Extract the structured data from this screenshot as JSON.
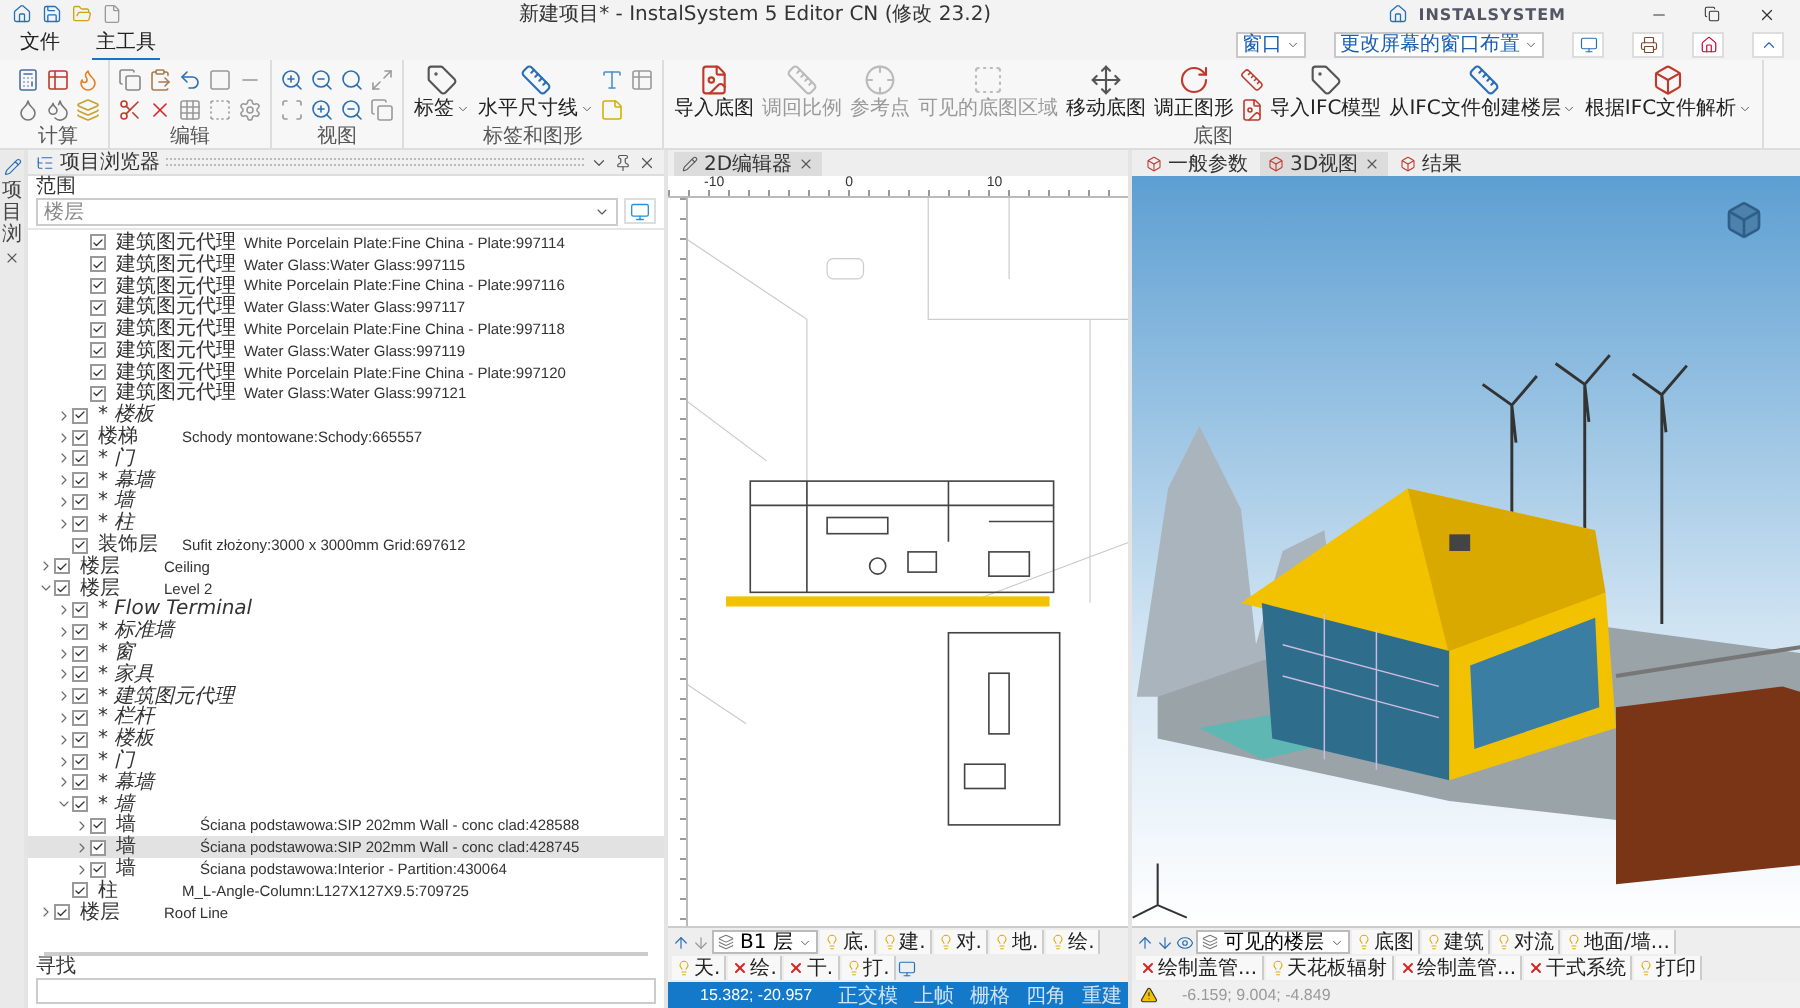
{
  "window": {
    "title": "新建项目* - InstalSystem 5 Editor CN (修改 23.2)",
    "logo": "INSTALSYSTEM"
  },
  "menu": [
    {
      "label": "文件",
      "selected": false
    },
    {
      "label": "主工具",
      "selected": true
    }
  ],
  "layout_controls": {
    "window_menu": "窗口",
    "layout_menu": "更改屏幕的窗口布置"
  },
  "ribbon": [
    {
      "kind": "calc",
      "label": "计算"
    },
    {
      "kind": "edit",
      "label": "编辑"
    },
    {
      "kind": "view",
      "label": "视图"
    },
    {
      "kind": "labels",
      "label": "标签和图形",
      "items": [
        {
          "kind": "large",
          "label": "标签",
          "menu": true,
          "disabled": false
        },
        {
          "kind": "large",
          "label": "水平尺寸线",
          "menu": true,
          "disabled": false
        },
        {
          "kind": "icons"
        }
      ]
    },
    {
      "kind": "underlay",
      "label": "底图",
      "items": [
        {
          "kind": "large",
          "label": "导入底图",
          "menu": false,
          "disabled": false
        },
        {
          "kind": "large",
          "label": "调回比例",
          "menu": false,
          "disabled": true
        },
        {
          "kind": "large",
          "label": "参考点",
          "menu": false,
          "disabled": true
        },
        {
          "kind": "large",
          "label": "可见的底图区域",
          "menu": false,
          "disabled": true
        },
        {
          "kind": "large",
          "label": "移动底图",
          "menu": false,
          "disabled": false
        },
        {
          "kind": "large",
          "label": "调正图形",
          "menu": false,
          "disabled": false
        },
        {
          "kind": "icons"
        },
        {
          "kind": "large",
          "label": "导入IFC模型",
          "menu": false,
          "disabled": false
        },
        {
          "kind": "large",
          "label": "从IFC文件创建楼层",
          "menu": true,
          "disabled": false
        },
        {
          "kind": "large",
          "label": "根据IFC文件解析",
          "menu": true,
          "disabled": false
        }
      ]
    }
  ],
  "side_strip": {
    "label": "项目浏"
  },
  "browser": {
    "title": "项目浏览器",
    "scope_label": "范围",
    "scope_value": "楼层",
    "search_label": "寻找",
    "tree": [
      {
        "kind": "offscreen",
        "children": [
          {
            "kind": "offscreen",
            "children": [
              {
                "kind": "element",
                "type": "建筑图元代理",
                "name": "White Porcelain Plate:Fine China - Plate:997114",
                "checked": true,
                "selected": false
              },
              {
                "kind": "element",
                "type": "建筑图元代理",
                "name": "Water Glass:Water Glass:997115",
                "checked": true,
                "selected": false
              },
              {
                "kind": "element",
                "type": "建筑图元代理",
                "name": "White Porcelain Plate:Fine China - Plate:997116",
                "checked": true,
                "selected": false
              },
              {
                "kind": "element",
                "type": "建筑图元代理",
                "name": "Water Glass:Water Glass:997117",
                "checked": true,
                "selected": false
              },
              {
                "kind": "element",
                "type": "建筑图元代理",
                "name": "White Porcelain Plate:Fine China - Plate:997118",
                "checked": true,
                "selected": false
              },
              {
                "kind": "element",
                "type": "建筑图元代理",
                "name": "Water Glass:Water Glass:997119",
                "checked": true,
                "selected": false
              },
              {
                "kind": "element",
                "type": "建筑图元代理",
                "name": "White Porcelain Plate:Fine China - Plate:997120",
                "checked": true,
                "selected": false
              },
              {
                "kind": "element",
                "type": "建筑图元代理",
                "name": "Water Glass:Water Glass:997121",
                "checked": true,
                "selected": false
              }
            ]
          },
          {
            "kind": "group",
            "label": "* 楼板",
            "checked": true,
            "expanded": false,
            "selected": false
          },
          {
            "kind": "element",
            "type": "楼梯",
            "name": "Schody montowane:Schody:665557",
            "checked": true,
            "expanded": false,
            "selected": false
          },
          {
            "kind": "group",
            "label": "* 门",
            "checked": true,
            "expanded": false,
            "selected": false
          },
          {
            "kind": "group",
            "label": "* 幕墙",
            "checked": true,
            "expanded": false,
            "selected": false
          },
          {
            "kind": "group",
            "label": "* 墙",
            "checked": true,
            "expanded": false,
            "selected": false
          },
          {
            "kind": "group",
            "label": "* 柱",
            "checked": true,
            "expanded": false,
            "selected": false
          },
          {
            "kind": "element",
            "type": "装饰层",
            "name": "Sufit złożony:3000 x 3000mm Grid:697612",
            "checked": true,
            "selected": false
          }
        ]
      },
      {
        "kind": "element",
        "type": "楼层",
        "name": "Ceiling",
        "checked": true,
        "expanded": false,
        "selected": false
      },
      {
        "kind": "element",
        "type": "楼层",
        "name": "Level 2",
        "checked": true,
        "expanded": true,
        "selected": false,
        "children": [
          {
            "kind": "group",
            "label": "* Flow Terminal",
            "checked": true,
            "expanded": false,
            "selected": false
          },
          {
            "kind": "group",
            "label": "* 标准墙",
            "checked": true,
            "expanded": false,
            "selected": false
          },
          {
            "kind": "group",
            "label": "* 窗",
            "checked": true,
            "expanded": false,
            "selected": false
          },
          {
            "kind": "group",
            "label": "* 家具",
            "checked": true,
            "expanded": false,
            "selected": false
          },
          {
            "kind": "group",
            "label": "* 建筑图元代理",
            "checked": true,
            "expanded": false,
            "selected": false
          },
          {
            "kind": "group",
            "label": "* 栏杆",
            "checked": true,
            "expanded": false,
            "selected": false
          },
          {
            "kind": "group",
            "label": "* 楼板",
            "checked": true,
            "expanded": false,
            "selected": false
          },
          {
            "kind": "group",
            "label": "* 门",
            "checked": true,
            "expanded": false,
            "selected": false
          },
          {
            "kind": "group",
            "label": "* 幕墙",
            "checked": true,
            "expanded": false,
            "selected": false
          },
          {
            "kind": "group",
            "label": "* 墙",
            "checked": true,
            "expanded": true,
            "selected": false,
            "children": [
              {
                "kind": "element",
                "type": "墙",
                "name": "Ściana podstawowa:SIP 202mm Wall - conc clad:428588",
                "checked": true,
                "expanded": false,
                "selected": false
              },
              {
                "kind": "element",
                "type": "墙",
                "name": "Ściana podstawowa:SIP 202mm Wall - conc clad:428745",
                "checked": true,
                "expanded": false,
                "selected": true
              },
              {
                "kind": "element",
                "type": "墙",
                "name": "Ściana podstawowa:Interior - Partition:430064",
                "checked": true,
                "expanded": false,
                "selected": false
              }
            ]
          },
          {
            "kind": "element",
            "type": "柱",
            "name": "M_L-Angle-Column:L127X127X9.5:709725",
            "checked": true,
            "selected": false
          }
        ]
      },
      {
        "kind": "element",
        "type": "楼层",
        "name": "Roof Line",
        "checked": true,
        "expanded": false,
        "selected": false
      }
    ]
  },
  "editor2d": {
    "tab": "2D编辑器",
    "ruler": [
      "-10",
      "0",
      "10"
    ],
    "floor": "B1 层",
    "layers": [
      {
        "label": "底.",
        "visible": true
      },
      {
        "label": "建.",
        "visible": true
      },
      {
        "label": "对.",
        "visible": true
      },
      {
        "label": "地.",
        "visible": true
      },
      {
        "label": "绘.",
        "visible": true
      },
      {
        "label": "天.",
        "visible": true
      },
      {
        "label": "绘.",
        "visible": false
      },
      {
        "label": "干.",
        "visible": false
      },
      {
        "label": "打.",
        "visible": true
      }
    ],
    "status": {
      "active": true,
      "coords": "15.382; -20.957",
      "toggles": [
        "正交模",
        "上帧",
        "栅格",
        "四角",
        "重建"
      ]
    }
  },
  "view3d": {
    "tabs": [
      {
        "label": "一般参数",
        "selected": false
      },
      {
        "label": "3D视图",
        "selected": true
      },
      {
        "label": "结果",
        "selected": false
      }
    ],
    "floor": "可见的楼层",
    "layers": [
      {
        "label": "底图",
        "visible": true
      },
      {
        "label": "建筑",
        "visible": true
      },
      {
        "label": "对流",
        "visible": true
      },
      {
        "label": "地面/墙...",
        "visible": true
      },
      {
        "label": "绘制盖管...",
        "visible": false
      },
      {
        "label": "天花板辐射",
        "visible": true
      },
      {
        "label": "绘制盖管...",
        "visible": false
      },
      {
        "label": "干式系统",
        "visible": false
      },
      {
        "label": "打印",
        "visible": true
      }
    ],
    "status": {
      "active": false,
      "coords": "-6.159; 9.004; -4.849"
    }
  }
}
